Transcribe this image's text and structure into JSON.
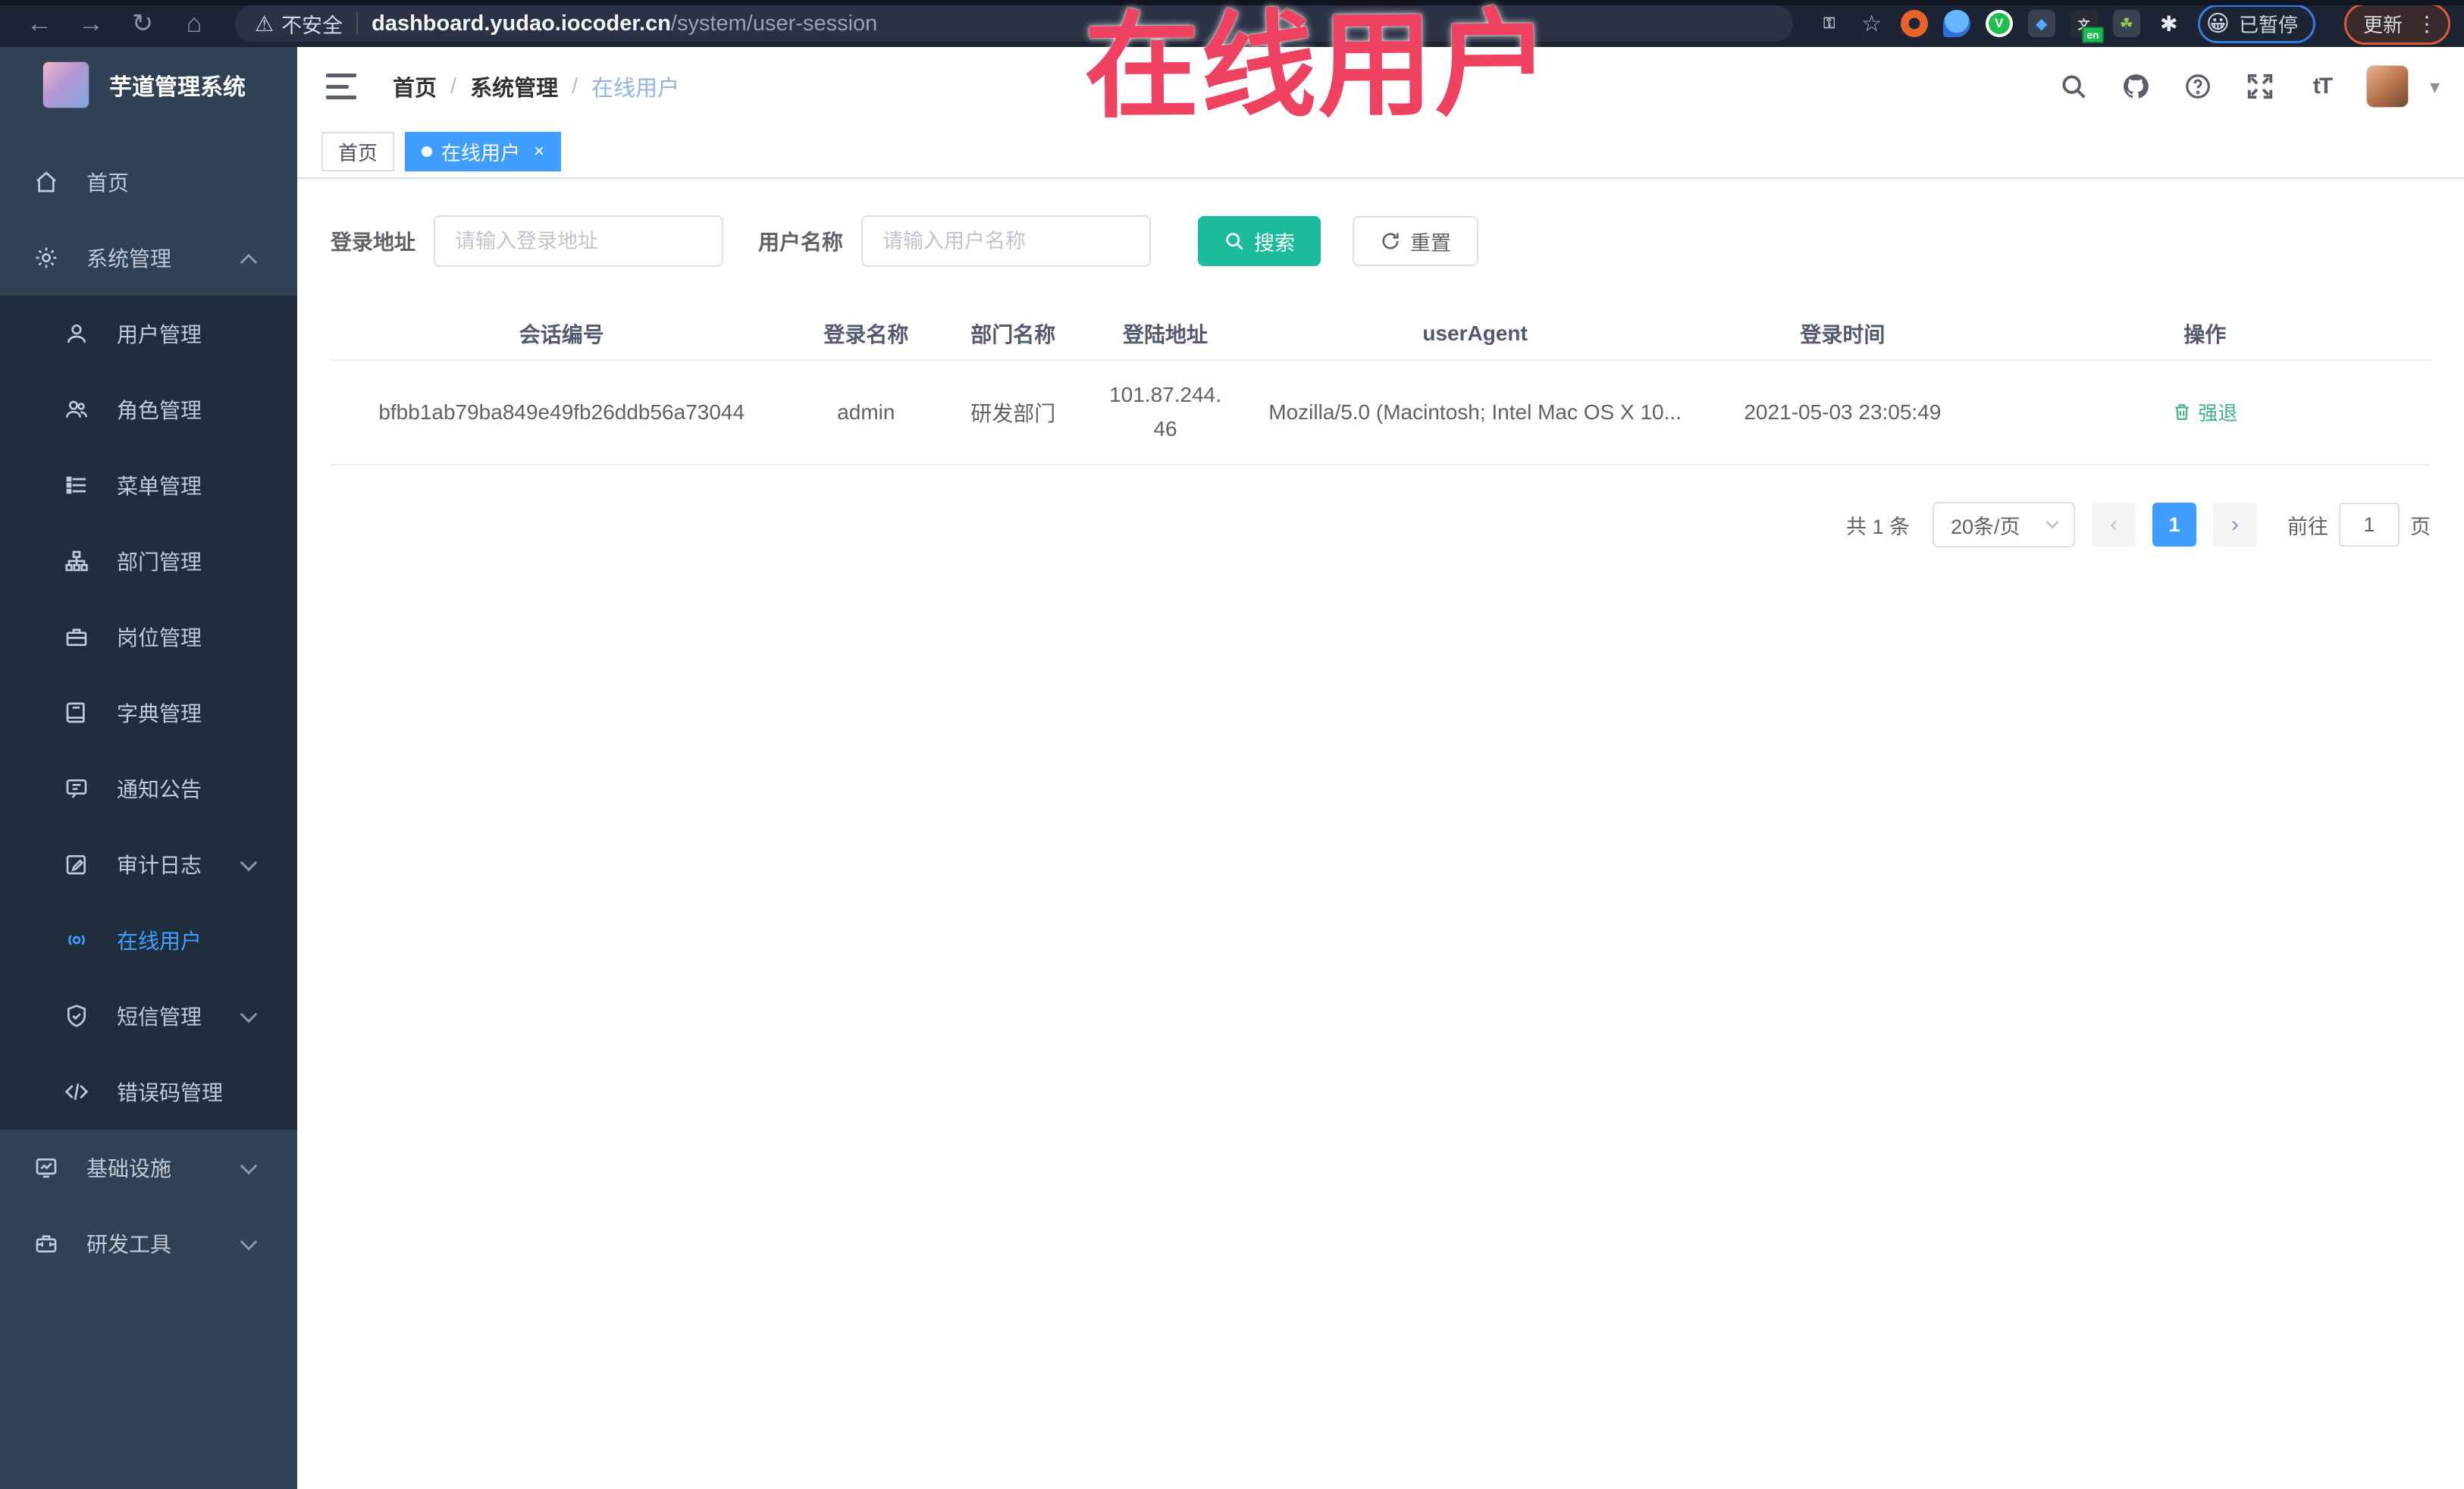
{
  "browser": {
    "insecure_label": "不安全",
    "url_domain": "dashboard.yudao.iocoder.cn",
    "url_path": "/system/user-session",
    "paused_badge": "已暂停",
    "update_button": "更新",
    "icons": {
      "back": "←",
      "forward": "→",
      "reload": "↻",
      "home": "⌂",
      "warning": "⚠",
      "key": "⚿",
      "star": "☆",
      "kebab": "⋮",
      "puzzle": "✱",
      "diamond": "◆",
      "vue": "V",
      "translate": "文",
      "translate_badge": "en",
      "proxy": "☘",
      "paused_emoji": "😀"
    }
  },
  "annotation": {
    "text": "在线用户",
    "color": "#ef4160"
  },
  "sidebar": {
    "title": "芋道管理系统",
    "items": [
      {
        "label": "首页"
      },
      {
        "label": "系统管理"
      },
      {
        "label": "用户管理"
      },
      {
        "label": "角色管理"
      },
      {
        "label": "菜单管理"
      },
      {
        "label": "部门管理"
      },
      {
        "label": "岗位管理"
      },
      {
        "label": "字典管理"
      },
      {
        "label": "通知公告"
      },
      {
        "label": "审计日志"
      },
      {
        "label": "在线用户"
      },
      {
        "label": "短信管理"
      },
      {
        "label": "错误码管理"
      },
      {
        "label": "基础设施"
      },
      {
        "label": "研发工具"
      }
    ]
  },
  "header": {
    "breadcrumb": [
      "首页",
      "系统管理",
      "在线用户"
    ],
    "separator": "/",
    "font_size_icon": "tT",
    "caret": "▾"
  },
  "tabs": [
    {
      "label": "首页"
    },
    {
      "label": "在线用户",
      "close": "×"
    }
  ],
  "search": {
    "login_addr_label": "登录地址",
    "login_addr_placeholder": "请输入登录地址",
    "username_label": "用户名称",
    "username_placeholder": "请输入用户名称",
    "search_button": "搜索",
    "reset_button": "重置"
  },
  "table": {
    "headers": [
      "会话编号",
      "登录名称",
      "部门名称",
      "登陆地址",
      "userAgent",
      "登录时间",
      "操作"
    ],
    "rows": [
      {
        "session_id": "bfbb1ab79ba849e49fb26ddb56a73044",
        "username": "admin",
        "dept": "研发部门",
        "ip": "101.87.244.46",
        "user_agent": "Mozilla/5.0 (Macintosh; Intel Mac OS X 10...",
        "login_time": "2021-05-03 23:05:49",
        "action": "强退"
      }
    ]
  },
  "pagination": {
    "total": "共 1 条",
    "page_size": "20条/页",
    "prev": "‹",
    "next": "›",
    "current_page": "1",
    "goto_label": "前往",
    "goto_value": "1",
    "page_label": "页"
  }
}
